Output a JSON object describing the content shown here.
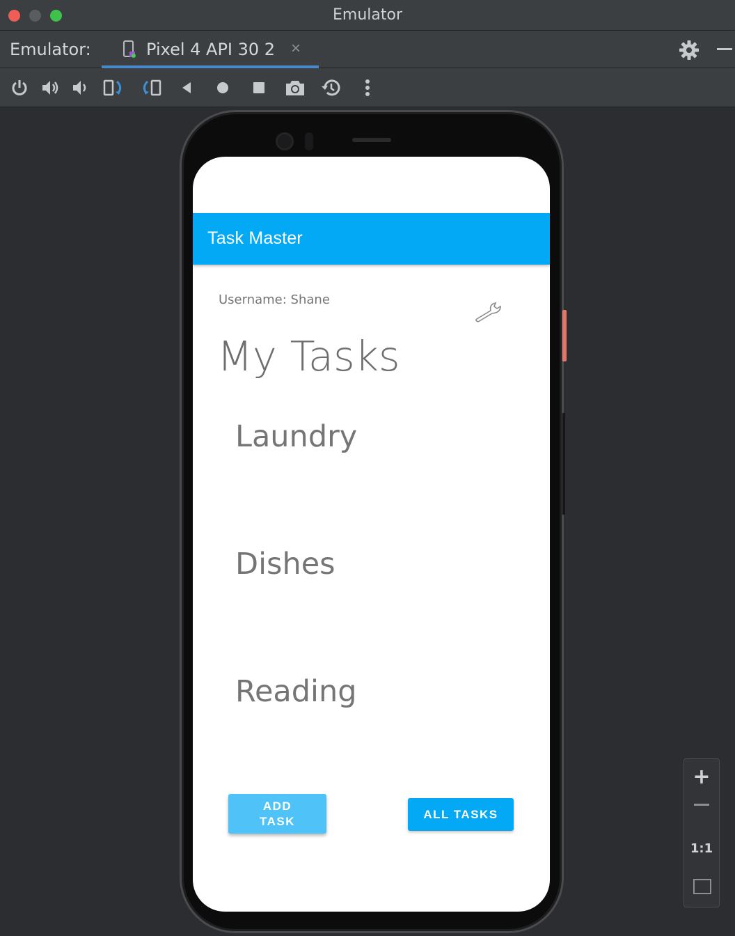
{
  "window": {
    "title": "Emulator"
  },
  "tabbar": {
    "prefix": "Emulator:",
    "device_tab": "Pixel 4 API 30 2",
    "close_glyph": "×"
  },
  "toolbar": {
    "icons": [
      "power-icon",
      "volume-up-icon",
      "volume-down-icon",
      "rotate-left-icon",
      "rotate-right-icon",
      "back-icon",
      "home-icon",
      "overview-icon",
      "camera-icon",
      "snapshot-icon",
      "more-icon"
    ]
  },
  "app": {
    "title": "Task Master",
    "username": "Username: Shane",
    "heading": "My Tasks",
    "tasks": [
      "Laundry",
      "Dishes",
      "Reading"
    ],
    "add_task_line1": "ADD",
    "add_task_line2": "TASK",
    "all_tasks": "ALL TASKS",
    "accent": "#03a9f4",
    "accent_light": "#4fc3f7"
  },
  "zoom": {
    "plus": "+",
    "one_to_one": "1:1"
  }
}
